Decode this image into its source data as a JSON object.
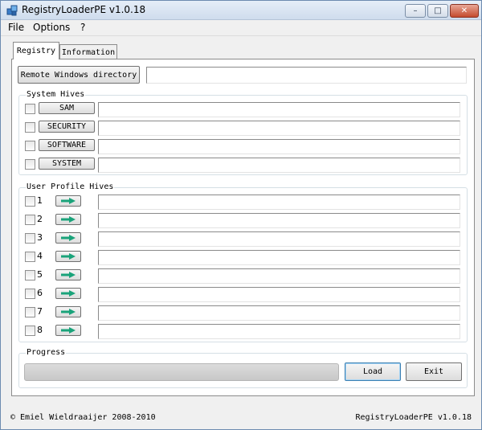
{
  "window": {
    "title": "RegistryLoaderPE v1.0.18",
    "minimize": "–",
    "maximize": "□",
    "close": "✕"
  },
  "menu": [
    "File",
    "Options",
    "?"
  ],
  "tabs": {
    "registry": "Registry",
    "information": "Information"
  },
  "remote": {
    "button_label": "Remote Windows directory",
    "value": ""
  },
  "system_hives": {
    "label": "System Hives",
    "items": [
      {
        "label": "SAM",
        "value": ""
      },
      {
        "label": "SECURITY",
        "value": ""
      },
      {
        "label": "SOFTWARE",
        "value": ""
      },
      {
        "label": "SYSTEM",
        "value": ""
      }
    ]
  },
  "user_profile_hives": {
    "label": "User Profile Hives",
    "items": [
      {
        "label": "1",
        "value": ""
      },
      {
        "label": "2",
        "value": ""
      },
      {
        "label": "3",
        "value": ""
      },
      {
        "label": "4",
        "value": ""
      },
      {
        "label": "5",
        "value": ""
      },
      {
        "label": "6",
        "value": ""
      },
      {
        "label": "7",
        "value": ""
      },
      {
        "label": "8",
        "value": ""
      }
    ]
  },
  "progress": {
    "label": "Progress",
    "value": 0
  },
  "actions": {
    "load": "Load",
    "exit": "Exit"
  },
  "footer": {
    "copyright": "© Emiel Wieldraaijer 2008-2010",
    "version": "RegistryLoaderPE v1.0.18"
  },
  "colors": {
    "arrow": "#1aa37a",
    "title_bar": "#cfdced",
    "close_button": "#c44a2d"
  }
}
